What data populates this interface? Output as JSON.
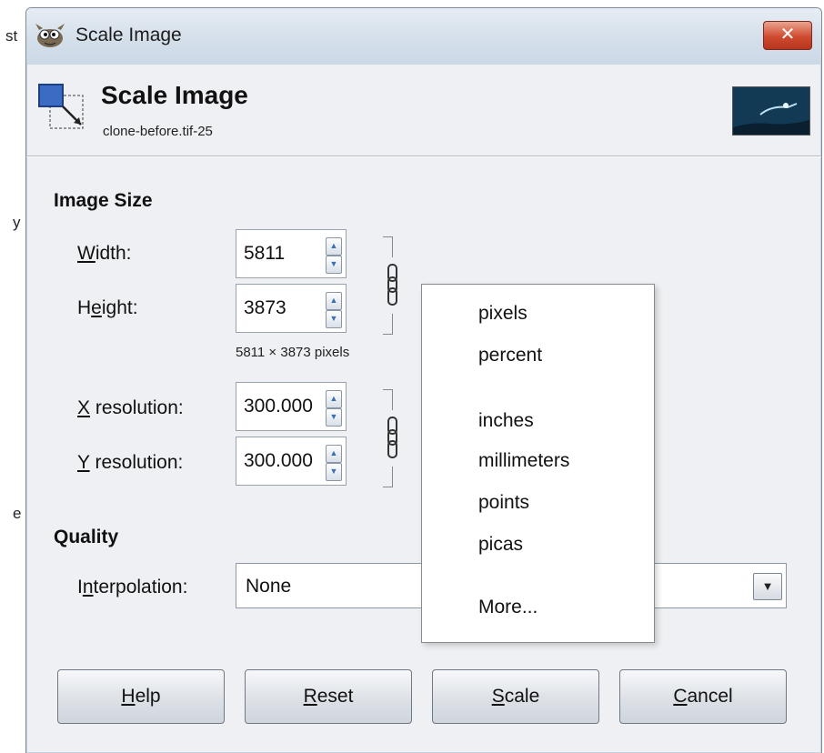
{
  "background_fragments": [
    "st",
    "y",
    "e"
  ],
  "window": {
    "title": "Scale Image",
    "close_label": "✕"
  },
  "header": {
    "title": "Scale Image",
    "subtitle": "clone-before.tif-25"
  },
  "image_size": {
    "section_title": "Image Size",
    "width": {
      "label_underlined": "W",
      "label_rest": "idth:",
      "value": "5811"
    },
    "height": {
      "label_pre": "H",
      "label_underlined": "e",
      "label_rest": "ight:",
      "value": "3873"
    },
    "size_info": "5811 × 3873 pixels",
    "x_resolution": {
      "label_underlined": "X",
      "label_rest": " resolution:",
      "value": "300.000"
    },
    "y_resolution": {
      "label_underlined": "Y",
      "label_rest": " resolution:",
      "value": "300.000"
    }
  },
  "quality": {
    "section_title": "Quality",
    "interpolation": {
      "label_pre": "I",
      "label_underlined": "n",
      "label_rest": "terpolation:",
      "value": "None"
    }
  },
  "unit_menu": {
    "items": [
      "pixels",
      "percent",
      "inches",
      "millimeters",
      "points",
      "picas",
      "More..."
    ]
  },
  "buttons": {
    "help": {
      "underlined": "H",
      "rest": "elp"
    },
    "reset": {
      "underlined": "R",
      "rest": "eset"
    },
    "scale": {
      "underlined": "S",
      "rest": "cale"
    },
    "cancel": {
      "underlined": "C",
      "rest": "ancel"
    }
  }
}
